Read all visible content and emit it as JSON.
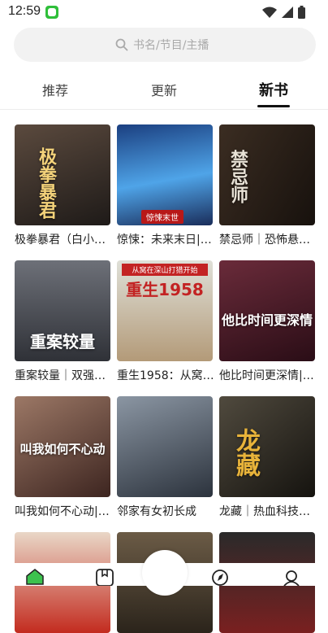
{
  "status": {
    "time": "12:59",
    "icons": [
      "wifi-icon",
      "signal-icon",
      "battery-icon"
    ]
  },
  "search": {
    "placeholder": "书名/节目/主播"
  },
  "tabs": [
    {
      "label": "推荐",
      "active": false
    },
    {
      "label": "更新",
      "active": false
    },
    {
      "label": "新书",
      "active": true
    }
  ],
  "books": [
    {
      "title": "极拳暴君（白小…",
      "cover_text": "极拳暴君",
      "cover_color": "#3a3431"
    },
    {
      "title": "惊悚：未来末日|…",
      "cover_text": "",
      "cover_badge": "惊悚末世",
      "cover_color": "#2b4a86"
    },
    {
      "title": "禁忌师｜恐怖悬…",
      "cover_text": "禁忌师",
      "cover_color": "#2a211c"
    },
    {
      "title": "重案较量｜双强…",
      "cover_text": "重案较量",
      "cover_color": "#4a4d55"
    },
    {
      "title": "重生1958：从窝…",
      "cover_text": "重生1958",
      "cover_top": "从窝在深山打猎开始",
      "cover_color": "#c9c3b3"
    },
    {
      "title": "他比时间更深情|…",
      "cover_text": "他比时间更深情",
      "cover_color": "#4a1d2a"
    },
    {
      "title": "叫我如何不心动|…",
      "cover_text": "叫我如何不心动",
      "cover_color": "#6a4a40"
    },
    {
      "title": "邻家有女初长成",
      "cover_text": "",
      "cover_color": "#5a6470"
    },
    {
      "title": "龙藏｜热血科技…",
      "cover_text": "龙藏",
      "cover_color": "#2d2a24"
    },
    {
      "title": "",
      "cover_text": "",
      "cover_color": "#c32b1f"
    },
    {
      "title": "",
      "cover_text": "",
      "cover_color": "#3a3228"
    },
    {
      "title": "",
      "cover_text": "",
      "cover_color": "#7a2020"
    }
  ],
  "nav": [
    "home-icon",
    "bookshelf-icon",
    "center-button",
    "discover-icon",
    "profile-icon"
  ]
}
